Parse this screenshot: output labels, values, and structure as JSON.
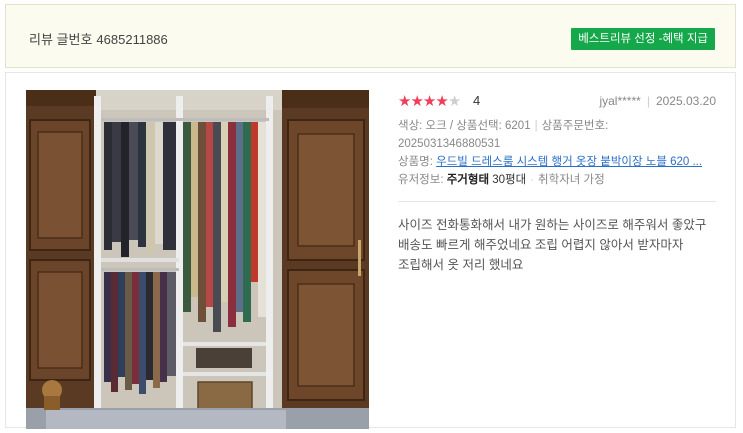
{
  "header": {
    "review_no_label": "리뷰 글번호",
    "review_no": "4685211886",
    "badge": "베스트리뷰 선정 -혜택 지급"
  },
  "review": {
    "rating": 4,
    "rating_max": 5,
    "score_text": "4",
    "user": "jyal*****",
    "date": "2025.03.20",
    "option_line": "색상: 오크 / 상품선택: 6201",
    "order_label": "상품주문번호:",
    "order_no": "2025031346880531",
    "product_label": "상품명:",
    "product_name": "우드빌 드레스룸 시스템 행거 옷장 붙박이장 노블 620 ...",
    "user_info_label": "유저정보:",
    "user_info_type": "주거형태",
    "user_info_size": "30평대",
    "user_info_extra": "취학자녀 가정",
    "body": "사이즈 전화통화해서 내가 원하는 사이즈로 해주워서 좋았구 배송도 빠르게 해주었네요 조립 어렵지 않아서 받자마자 조립해서 옷 저리 했네요"
  },
  "colors": {
    "badge_bg": "#14a84a",
    "star_on": "#f03e5a",
    "link": "#2a6fc9",
    "header_bg": "#fbfbef"
  }
}
